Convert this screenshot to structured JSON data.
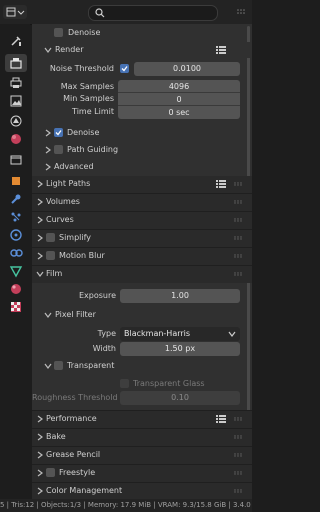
{
  "search": {
    "placeholder": ""
  },
  "panels": {
    "denoise_top": "Denoise",
    "render": {
      "title": "Render",
      "noise_threshold_label": "Noise Threshold",
      "noise_threshold_value": "0.0100",
      "max_samples_label": "Max Samples",
      "max_samples_value": "4096",
      "min_samples_label": "Min Samples",
      "min_samples_value": "0",
      "time_limit_label": "Time Limit",
      "time_limit_value": "0 sec"
    },
    "denoise": "Denoise",
    "path_guiding": "Path Guiding",
    "advanced": "Advanced",
    "light_paths": "Light Paths",
    "volumes": "Volumes",
    "curves": "Curves",
    "simplify": "Simplify",
    "motion_blur": "Motion Blur",
    "film": {
      "title": "Film",
      "exposure_label": "Exposure",
      "exposure_value": "1.00",
      "pixel_filter": "Pixel Filter",
      "type_label": "Type",
      "type_value": "Blackman-Harris",
      "width_label": "Width",
      "width_value": "1.50 px",
      "transparent": "Transparent",
      "transparent_glass": "Transparent Glass",
      "roughness_label": "Roughness Threshold",
      "roughness_value": "0.10"
    },
    "performance": "Performance",
    "bake": "Bake",
    "grease_pencil": "Grease Pencil",
    "freestyle": "Freestyle",
    "color_management": "Color Management"
  },
  "status": "5 | Tris:12 | Objects:1/3 | Memory: 17.9 MiB | VRAM: 9.3/15.8 GiB | 3.4.0",
  "colors": {
    "accent": "#4772b3",
    "panel": "#303030",
    "field": "#545454"
  }
}
